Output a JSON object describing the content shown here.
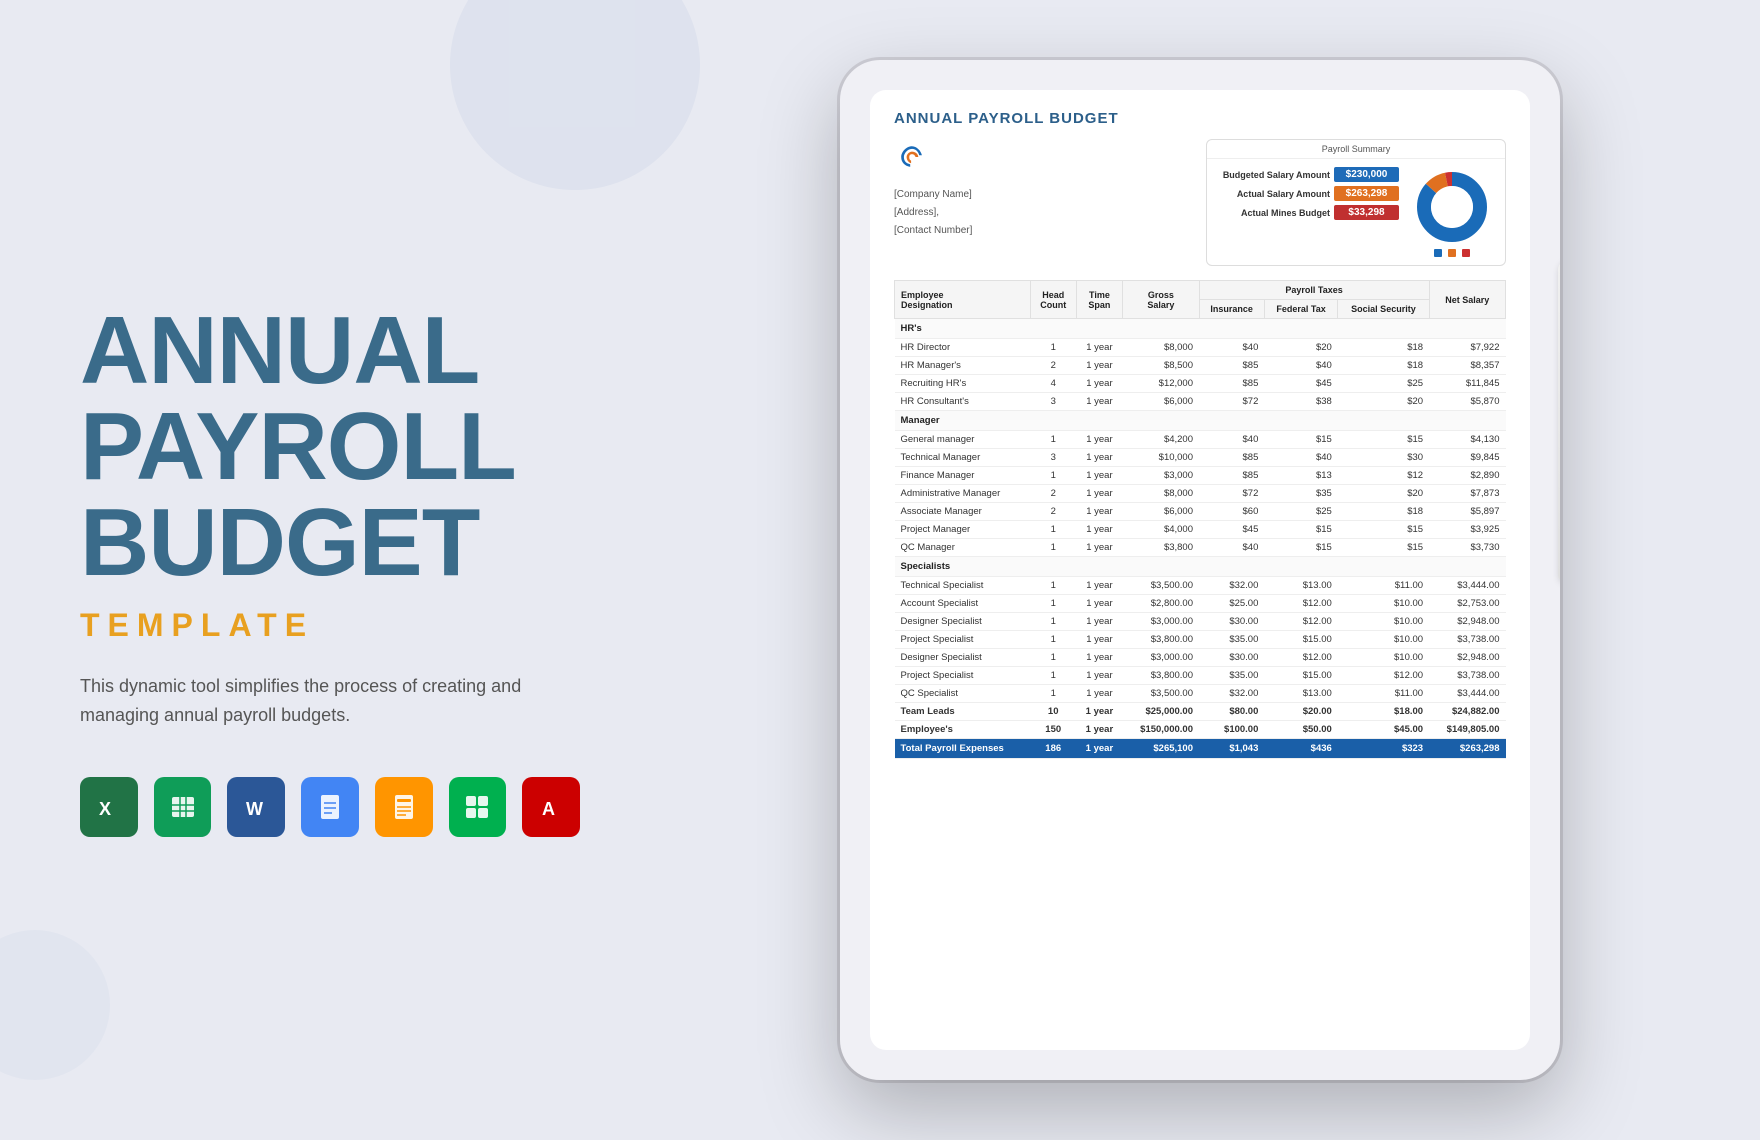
{
  "background": {
    "color": "#e8eaf2"
  },
  "left": {
    "title_line1": "ANNUAL",
    "title_line2": "PAYROLL",
    "title_line3": "BUDGET",
    "subtitle": "TEMPLATE",
    "description": "This dynamic tool simplifies the process of creating and managing annual payroll budgets.",
    "app_icons": [
      {
        "name": "Excel",
        "label": "X",
        "color_class": "icon-excel"
      },
      {
        "name": "Google Sheets",
        "label": "≡",
        "color_class": "icon-sheets"
      },
      {
        "name": "Word",
        "label": "W",
        "color_class": "icon-word"
      },
      {
        "name": "Google Docs",
        "label": "≡",
        "color_class": "icon-docs"
      },
      {
        "name": "Pages",
        "label": "P",
        "color_class": "icon-pages"
      },
      {
        "name": "Numbers",
        "label": "N",
        "color_class": "icon-numbers"
      },
      {
        "name": "Acrobat",
        "label": "A",
        "color_class": "icon-acrobat"
      }
    ]
  },
  "document": {
    "title": "ANNUAL PAYROLL BUDGET",
    "company_name": "[Company Name]",
    "address": "[Address],",
    "contact": "[Contact Number]",
    "summary": {
      "title": "Payroll Summary",
      "rows": [
        {
          "label": "Budgeted Salary Amount",
          "value": "$230,000",
          "color_class": "val-blue"
        },
        {
          "label": "Actual Salary Amount",
          "value": "$263,298",
          "color_class": "val-orange"
        },
        {
          "label": "Actual Mines Budget",
          "value": "$33,298",
          "color_class": "val-red"
        }
      ]
    },
    "table": {
      "headers": {
        "designation": "Employee Designation",
        "head_count": "Head Count",
        "time_span": "Time Span",
        "gross_salary": "Gross Salary",
        "payroll_taxes": "Payroll Taxes",
        "insurance": "Insurance",
        "federal_tax": "Federal Tax",
        "social_security": "Social Security",
        "net_salary": "Net Salary"
      },
      "sections": [
        {
          "section_name": "HR's",
          "rows": [
            {
              "designation": "HR Director",
              "head_count": "1",
              "time_span": "1 year",
              "gross_salary": "$8,000",
              "insurance": "$40",
              "federal_tax": "$20",
              "social_security": "$18",
              "net_salary": "$7,922"
            },
            {
              "designation": "HR Manager's",
              "head_count": "2",
              "time_span": "1 year",
              "gross_salary": "$8,500",
              "insurance": "$85",
              "federal_tax": "$40",
              "social_security": "$18",
              "net_salary": "$8,357"
            },
            {
              "designation": "Recruiting HR's",
              "head_count": "4",
              "time_span": "1 year",
              "gross_salary": "$12,000",
              "insurance": "$85",
              "federal_tax": "$45",
              "social_security": "$25",
              "net_salary": "$11,845"
            },
            {
              "designation": "HR Consultant's",
              "head_count": "3",
              "time_span": "1 year",
              "gross_salary": "$6,000",
              "insurance": "$72",
              "federal_tax": "$38",
              "social_security": "$20",
              "net_salary": "$5,870"
            }
          ]
        },
        {
          "section_name": "Manager",
          "rows": [
            {
              "designation": "General manager",
              "head_count": "1",
              "time_span": "1 year",
              "gross_salary": "$4,200",
              "insurance": "$40",
              "federal_tax": "$15",
              "social_security": "$15",
              "net_salary": "$4,130"
            },
            {
              "designation": "Technical Manager",
              "head_count": "3",
              "time_span": "1 year",
              "gross_salary": "$10,000",
              "insurance": "$85",
              "federal_tax": "$40",
              "social_security": "$30",
              "net_salary": "$9,845"
            },
            {
              "designation": "Finance Manager",
              "head_count": "1",
              "time_span": "1 year",
              "gross_salary": "$3,000",
              "insurance": "$85",
              "federal_tax": "$13",
              "social_security": "$12",
              "net_salary": "$2,890"
            },
            {
              "designation": "Administrative Manager",
              "head_count": "2",
              "time_span": "1 year",
              "gross_salary": "$8,000",
              "insurance": "$72",
              "federal_tax": "$35",
              "social_security": "$20",
              "net_salary": "$7,873"
            },
            {
              "designation": "Associate Manager",
              "head_count": "2",
              "time_span": "1 year",
              "gross_salary": "$6,000",
              "insurance": "$60",
              "federal_tax": "$25",
              "social_security": "$18",
              "net_salary": "$5,897"
            },
            {
              "designation": "Project Manager",
              "head_count": "1",
              "time_span": "1 year",
              "gross_salary": "$4,000",
              "insurance": "$45",
              "federal_tax": "$15",
              "social_security": "$15",
              "net_salary": "$3,925"
            },
            {
              "designation": "QC Manager",
              "head_count": "1",
              "time_span": "1 year",
              "gross_salary": "$3,800",
              "insurance": "$40",
              "federal_tax": "$15",
              "social_security": "$15",
              "net_salary": "$3,730"
            }
          ]
        },
        {
          "section_name": "Specialists",
          "rows": [
            {
              "designation": "Technical Specialist",
              "head_count": "1",
              "time_span": "1 year",
              "gross_salary": "$3,500.00",
              "insurance": "$32.00",
              "federal_tax": "$13.00",
              "social_security": "$11.00",
              "net_salary": "$3,444.00"
            },
            {
              "designation": "Account Specialist",
              "head_count": "1",
              "time_span": "1 year",
              "gross_salary": "$2,800.00",
              "insurance": "$25.00",
              "federal_tax": "$12.00",
              "social_security": "$10.00",
              "net_salary": "$2,753.00"
            },
            {
              "designation": "Designer Specialist",
              "head_count": "1",
              "time_span": "1 year",
              "gross_salary": "$3,000.00",
              "insurance": "$30.00",
              "federal_tax": "$12.00",
              "social_security": "$10.00",
              "net_salary": "$2,948.00"
            },
            {
              "designation": "Project Specialist",
              "head_count": "1",
              "time_span": "1 year",
              "gross_salary": "$3,800.00",
              "insurance": "$35.00",
              "federal_tax": "$15.00",
              "social_security": "$10.00",
              "net_salary": "$3,738.00"
            },
            {
              "designation": "Designer Specialist",
              "head_count": "1",
              "time_span": "1 year",
              "gross_salary": "$3,000.00",
              "insurance": "$30.00",
              "federal_tax": "$12.00",
              "social_security": "$10.00",
              "net_salary": "$2,948.00"
            },
            {
              "designation": "Project Specialist",
              "head_count": "1",
              "time_span": "1 year",
              "gross_salary": "$3,800.00",
              "insurance": "$35.00",
              "federal_tax": "$15.00",
              "social_security": "$12.00",
              "net_salary": "$3,738.00"
            },
            {
              "designation": "QC Specialist",
              "head_count": "1",
              "time_span": "1 year",
              "gross_salary": "$3,500.00",
              "insurance": "$32.00",
              "federal_tax": "$13.00",
              "social_security": "$11.00",
              "net_salary": "$3,444.00"
            }
          ]
        }
      ],
      "special_rows": [
        {
          "designation": "Team Leads",
          "head_count": "10",
          "time_span": "1 year",
          "gross_salary": "$25,000.00",
          "insurance": "$80.00",
          "federal_tax": "$20.00",
          "social_security": "$18.00",
          "net_salary": "$24,882.00",
          "bold": true
        },
        {
          "designation": "Employee's",
          "head_count": "150",
          "time_span": "1 year",
          "gross_salary": "$150,000.00",
          "insurance": "$100.00",
          "federal_tax": "$50.00",
          "social_security": "$45.00",
          "net_salary": "$149,805.00",
          "bold": true
        }
      ],
      "total_row": {
        "designation": "Total Payroll Expenses",
        "head_count": "186",
        "time_span": "1 year",
        "gross_salary": "$265,100",
        "insurance": "$1,043",
        "federal_tax": "$436",
        "social_security": "$323",
        "net_salary": "$263,298"
      }
    }
  }
}
